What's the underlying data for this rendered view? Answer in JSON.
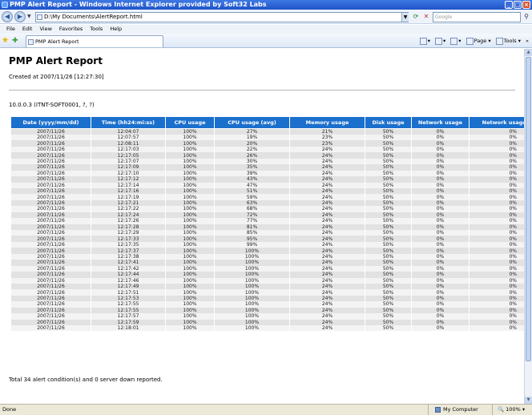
{
  "window": {
    "title": "PMP Alert Report - Windows Internet Explorer provided by Soft32 Labs"
  },
  "addressbar": {
    "url": "D:\\My Documents\\AlertReport.html",
    "search_placeholder": "Google"
  },
  "menu": [
    "File",
    "Edit",
    "View",
    "Favorites",
    "Tools",
    "Help"
  ],
  "tab": {
    "title": "PMP Alert Report"
  },
  "toolbar": {
    "page_label": "Page",
    "tools_label": "Tools"
  },
  "report": {
    "title": "PMP Alert Report",
    "created": "Created at 2007/11/26 [12:27:30]",
    "host": "10.0.0.3 (ITNT-SOFT0001, ?, ?)",
    "columns": [
      "Date (yyyy/mm/dd)",
      "Time (hh24:mi:ss)",
      "CPU usage",
      "CPU usage (avg)",
      "Memory usage",
      "Disk usage",
      "Network usage",
      "Network usage (avg)"
    ],
    "rows": [
      [
        "2007/11/26",
        "12:04:07",
        "100%",
        "27%",
        "21%",
        "50%",
        "0%",
        "0%"
      ],
      [
        "2007/11/26",
        "12:07:57",
        "100%",
        "19%",
        "23%",
        "50%",
        "0%",
        "0%"
      ],
      [
        "2007/11/26",
        "12:08:11",
        "100%",
        "20%",
        "23%",
        "50%",
        "0%",
        "0%"
      ],
      [
        "2007/11/26",
        "12:17:03",
        "100%",
        "22%",
        "24%",
        "50%",
        "0%",
        "0%"
      ],
      [
        "2007/11/26",
        "12:17:05",
        "100%",
        "26%",
        "24%",
        "50%",
        "0%",
        "0%"
      ],
      [
        "2007/11/26",
        "12:17:07",
        "100%",
        "30%",
        "24%",
        "50%",
        "0%",
        "0%"
      ],
      [
        "2007/11/26",
        "12:17:09",
        "100%",
        "35%",
        "24%",
        "50%",
        "0%",
        "0%"
      ],
      [
        "2007/11/26",
        "12:17:10",
        "100%",
        "39%",
        "24%",
        "50%",
        "0%",
        "0%"
      ],
      [
        "2007/11/26",
        "12:17:12",
        "100%",
        "43%",
        "24%",
        "50%",
        "0%",
        "0%"
      ],
      [
        "2007/11/26",
        "12:17:14",
        "100%",
        "47%",
        "24%",
        "50%",
        "0%",
        "0%"
      ],
      [
        "2007/11/26",
        "12:17:16",
        "100%",
        "51%",
        "24%",
        "50%",
        "0%",
        "0%"
      ],
      [
        "2007/11/26",
        "12:17:19",
        "100%",
        "59%",
        "24%",
        "50%",
        "0%",
        "0%"
      ],
      [
        "2007/11/26",
        "12:17:21",
        "100%",
        "63%",
        "24%",
        "50%",
        "0%",
        "0%"
      ],
      [
        "2007/11/26",
        "12:17:22",
        "100%",
        "68%",
        "24%",
        "50%",
        "0%",
        "0%"
      ],
      [
        "2007/11/26",
        "12:17:24",
        "100%",
        "72%",
        "24%",
        "50%",
        "0%",
        "0%"
      ],
      [
        "2007/11/26",
        "12:17:26",
        "100%",
        "77%",
        "24%",
        "50%",
        "0%",
        "0%"
      ],
      [
        "2007/11/26",
        "12:17:28",
        "100%",
        "81%",
        "24%",
        "50%",
        "0%",
        "0%"
      ],
      [
        "2007/11/26",
        "12:17:29",
        "100%",
        "85%",
        "24%",
        "50%",
        "0%",
        "0%"
      ],
      [
        "2007/11/26",
        "12:17:33",
        "100%",
        "95%",
        "24%",
        "50%",
        "0%",
        "0%"
      ],
      [
        "2007/11/26",
        "12:17:35",
        "100%",
        "99%",
        "24%",
        "50%",
        "0%",
        "0%"
      ],
      [
        "2007/11/26",
        "12:17:37",
        "100%",
        "100%",
        "24%",
        "50%",
        "0%",
        "0%"
      ],
      [
        "2007/11/26",
        "12:17:38",
        "100%",
        "100%",
        "24%",
        "50%",
        "0%",
        "0%"
      ],
      [
        "2007/11/26",
        "12:17:41",
        "100%",
        "100%",
        "24%",
        "50%",
        "0%",
        "0%"
      ],
      [
        "2007/11/26",
        "12:17:42",
        "100%",
        "100%",
        "24%",
        "50%",
        "0%",
        "0%"
      ],
      [
        "2007/11/26",
        "12:17:44",
        "100%",
        "100%",
        "24%",
        "50%",
        "0%",
        "0%"
      ],
      [
        "2007/11/26",
        "12:17:46",
        "100%",
        "100%",
        "24%",
        "50%",
        "0%",
        "0%"
      ],
      [
        "2007/11/26",
        "12:17:49",
        "100%",
        "100%",
        "24%",
        "50%",
        "0%",
        "0%"
      ],
      [
        "2007/11/26",
        "12:17:51",
        "100%",
        "100%",
        "24%",
        "50%",
        "0%",
        "0%"
      ],
      [
        "2007/11/26",
        "12:17:53",
        "100%",
        "100%",
        "24%",
        "50%",
        "0%",
        "0%"
      ],
      [
        "2007/11/26",
        "12:17:55",
        "100%",
        "100%",
        "24%",
        "50%",
        "0%",
        "0%"
      ],
      [
        "2007/11/26",
        "12:17:55",
        "100%",
        "100%",
        "24%",
        "50%",
        "0%",
        "0%"
      ],
      [
        "2007/11/26",
        "12:17:57",
        "100%",
        "100%",
        "24%",
        "50%",
        "0%",
        "0%"
      ],
      [
        "2007/11/26",
        "12:17:59",
        "100%",
        "100%",
        "24%",
        "50%",
        "0%",
        "0%"
      ],
      [
        "2007/11/26",
        "12:18:01",
        "100%",
        "100%",
        "24%",
        "50%",
        "0%",
        "0%"
      ]
    ],
    "total": "Total 34 alert condition(s) and 0 server down reported."
  },
  "status": {
    "left": "Done",
    "zone": "My Computer",
    "zoom": "100%"
  },
  "colors": {
    "header_bg": "#1b6fcd",
    "row_odd": "#e2e2e2",
    "row_even": "#f3f3f3"
  }
}
